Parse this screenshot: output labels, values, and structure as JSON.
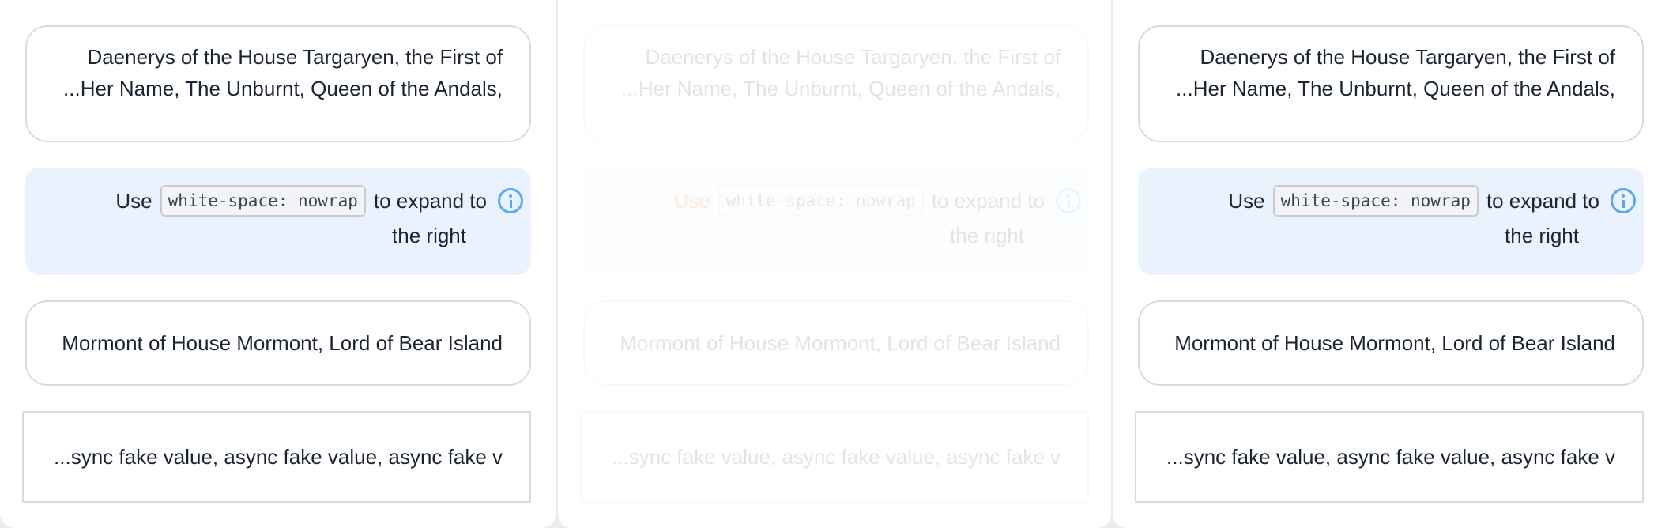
{
  "panels": [
    {
      "id": "left",
      "multiline_lines": [
        "Daenerys of the House Targaryen, the First of",
        "...Her Name, The Unburnt, Queen of the Andals,"
      ],
      "info": {
        "before": "Use",
        "code": "white-space: nowrap",
        "after": "to expand to",
        "second_line": "the right"
      },
      "single_line": "Mormont of House Mormont, Lord of Bear Island",
      "async_value": "...sync fake value, async fake value, async fake v"
    },
    {
      "id": "middle",
      "multiline_lines": [
        "Daenerys of the House Targaryen, the First of",
        "...Her Name, The Unburnt, Queen of the Andals,"
      ],
      "info": {
        "before": "Use",
        "code": "white-space: nowrap",
        "after": "to expand to",
        "second_line": "the right"
      },
      "single_line": "Mormont of House Mormont, Lord of Bear Island",
      "async_value": "...sync fake value, async fake value, async fake v"
    },
    {
      "id": "right",
      "multiline_lines": [
        "Daenerys of the House Targaryen, the First of",
        "...Her Name, The Unburnt, Queen of the Andals,"
      ],
      "info": {
        "before": "Use",
        "code": "white-space: nowrap",
        "after": "to expand to",
        "second_line": "the right"
      },
      "single_line": "Mormont of House Mormont, Lord of Bear Island",
      "async_value": "...sync fake value, async fake value, async fake v"
    }
  ],
  "colors": {
    "info_background": "#eaf3fd",
    "info_icon": "#5aa8ee",
    "border": "#d6dae1",
    "text": "#1b2433"
  },
  "icons": {
    "info": "info-circle-icon"
  }
}
